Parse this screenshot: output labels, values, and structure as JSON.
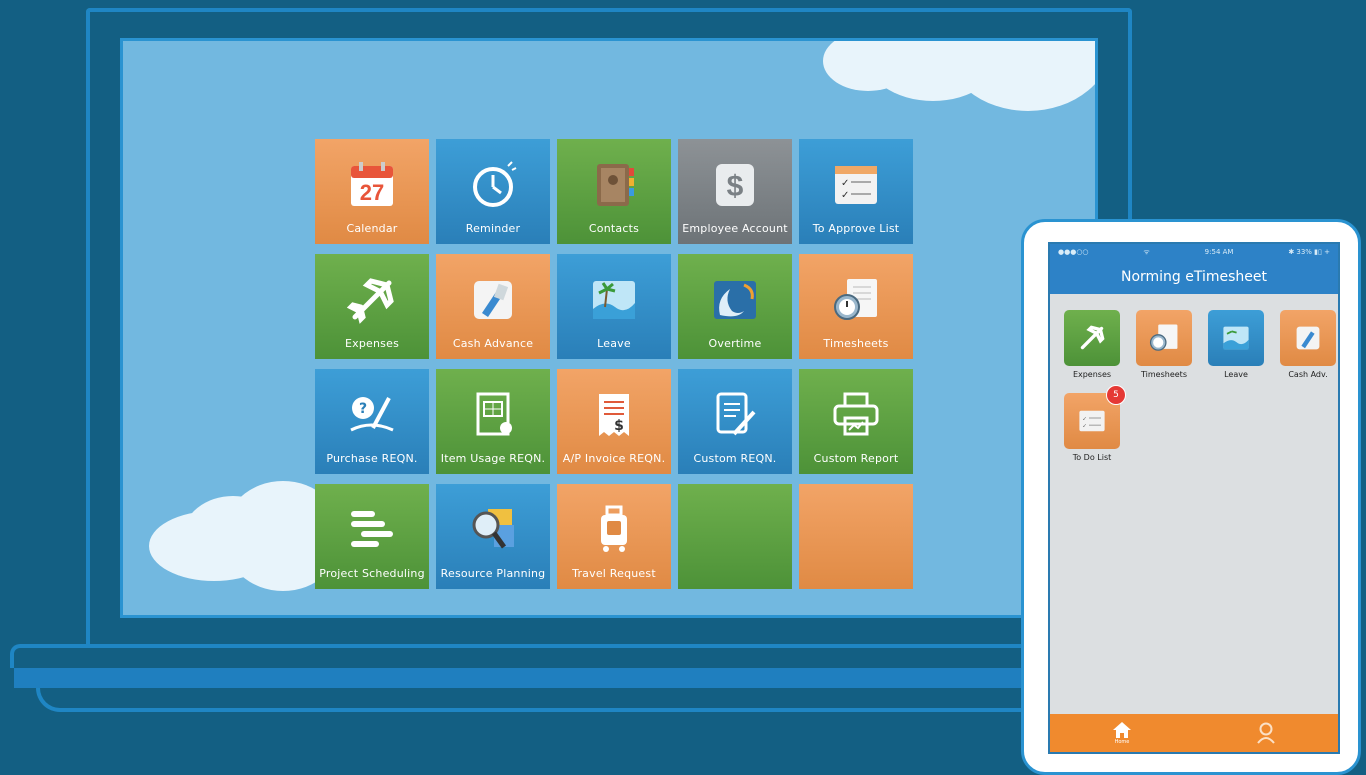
{
  "laptop": {
    "tiles": [
      {
        "label": "Calendar",
        "icon": "calendar-icon",
        "color": "orange",
        "day": "27"
      },
      {
        "label": "Reminder",
        "icon": "clock-icon",
        "color": "blue"
      },
      {
        "label": "Contacts",
        "icon": "address-book-icon",
        "color": "green"
      },
      {
        "label": "Employee Account",
        "icon": "dollar-icon",
        "color": "gray"
      },
      {
        "label": "To Approve List",
        "icon": "checklist-icon",
        "color": "blue"
      },
      {
        "label": "Expenses",
        "icon": "airplane-icon",
        "color": "green"
      },
      {
        "label": "Cash Advance",
        "icon": "cash-card-icon",
        "color": "orange"
      },
      {
        "label": "Leave",
        "icon": "beach-icon",
        "color": "blue"
      },
      {
        "label": "Overtime",
        "icon": "moon-face-icon",
        "color": "green"
      },
      {
        "label": "Timesheets",
        "icon": "stopwatch-sheet-icon",
        "color": "orange"
      },
      {
        "label": "Purchase REQN.",
        "icon": "question-pen-icon",
        "color": "blue"
      },
      {
        "label": "Item Usage REQN.",
        "icon": "item-form-icon",
        "color": "green"
      },
      {
        "label": "A/P Invoice REQN.",
        "icon": "invoice-icon",
        "color": "orange"
      },
      {
        "label": "Custom REQN.",
        "icon": "document-pen-icon",
        "color": "blue"
      },
      {
        "label": "Custom Report",
        "icon": "printer-icon",
        "color": "green"
      },
      {
        "label": "Project Scheduling",
        "icon": "gantt-icon",
        "color": "green"
      },
      {
        "label": "Resource Planning",
        "icon": "magnifier-icon",
        "color": "blue"
      },
      {
        "label": "Travel Request",
        "icon": "luggage-icon",
        "color": "orange"
      },
      {
        "label": "",
        "icon": "",
        "color": "green"
      },
      {
        "label": "",
        "icon": "",
        "color": "orange"
      }
    ]
  },
  "phone": {
    "status": {
      "carrier": "●●●○○",
      "wifi": "ᯤ",
      "time": "9:54 AM",
      "battery": "✱ 33% ▮▯ +"
    },
    "title": "Norming eTimesheet",
    "apps": [
      {
        "label": "Expenses",
        "icon": "airplane-icon",
        "color": "green"
      },
      {
        "label": "Timesheets",
        "icon": "stopwatch-sheet-icon",
        "color": "orange"
      },
      {
        "label": "Leave",
        "icon": "beach-icon",
        "color": "blue"
      },
      {
        "label": "Cash Adv.",
        "icon": "cash-card-icon",
        "color": "orange"
      },
      {
        "label": "To Do List",
        "icon": "checklist-icon",
        "color": "orange",
        "badge": "5"
      }
    ],
    "tabs": [
      {
        "label": "Home",
        "icon": "home-icon"
      },
      {
        "label": "",
        "icon": "user-icon"
      }
    ]
  }
}
